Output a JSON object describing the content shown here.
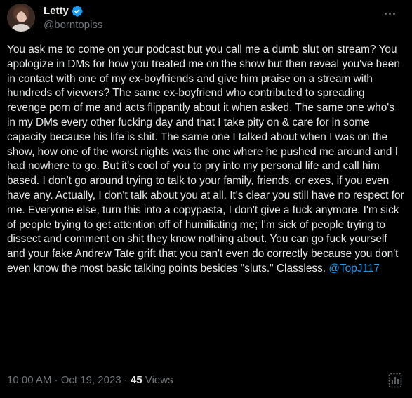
{
  "author": {
    "display_name": "Letty",
    "handle": "@borntopiss",
    "verified_badge_color": "#1d9bf0",
    "avatar_icon": "profile-photo"
  },
  "more_icon": "more-horizontal-icon",
  "tweet": {
    "text": "You ask me to come on your podcast but you call me a dumb slut on stream? You apologize in DMs for how you treated me on the show but then reveal you've been in contact with one of my ex-boyfriends and give him praise on a stream with hundreds of viewers? The same ex-boyfriend who contributed to spreading revenge porn of me and acts flippantly about it when asked. The same one who's in my DMs every other fucking day and that I take pity on & care for in some capacity because his life is shit. The same one I talked about when I was on the show, how one of the worst nights was the one where he pushed me around and I had nowhere to go. But it's cool of you to pry into my personal life and call him based. I don't go around trying to talk to your family, friends, or exes, if you even have any. Actually, I don't talk about you at all. It's clear you still have no respect for me. Everyone else, turn this into a copypasta, I don't give a fuck anymore. I'm sick of people trying to get attention off of humiliating me; I'm sick of people trying to dissect and comment on shit they know nothing about. You can go fuck yourself and your fake Andrew Tate grift that you can't even do correctly because you don't even know the most basic talking points besides \"sluts.\" Classless. ",
    "mention": "@TopJ117",
    "mention_color": "#1d9bf0"
  },
  "meta": {
    "time": "10:00 AM",
    "separator1": " · ",
    "date": "Oct 19, 2023",
    "separator2": " · ",
    "views_count": "45",
    "views_label": " Views"
  },
  "analytics_icon": "analytics-icon",
  "colors": {
    "background": "#000000",
    "text": "#e7e9ea",
    "secondary": "#71767b"
  }
}
